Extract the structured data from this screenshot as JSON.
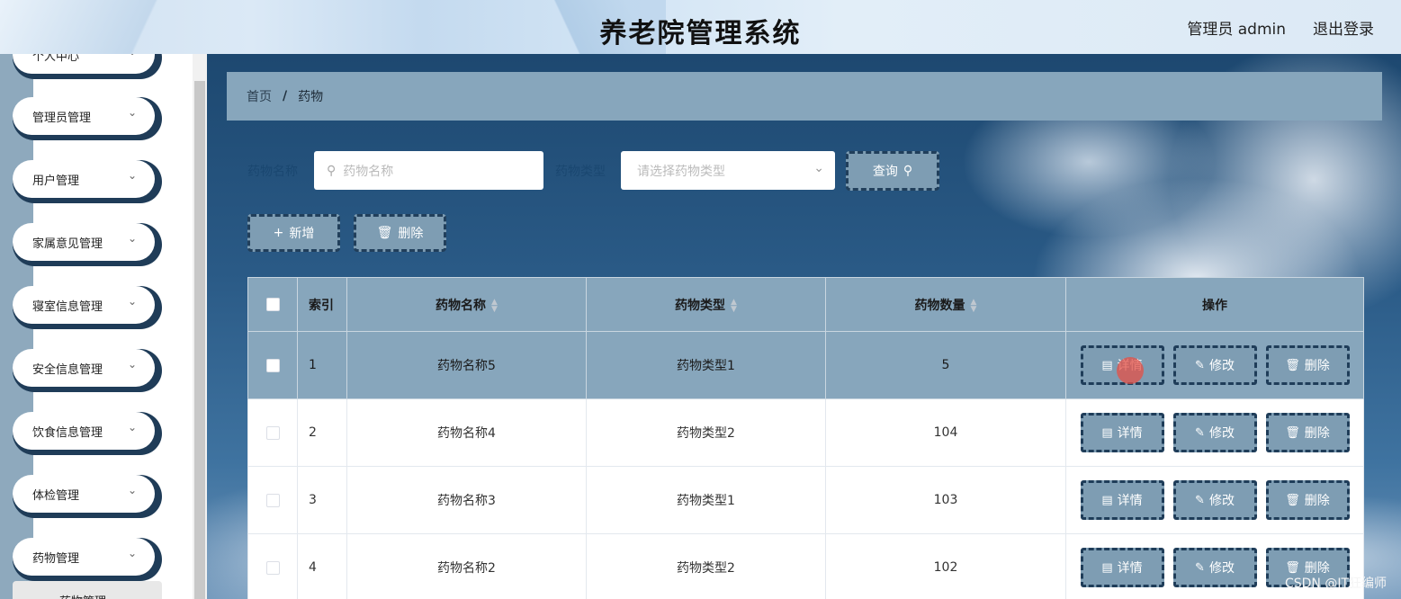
{
  "header": {
    "title": "养老院管理系统",
    "user": "管理员 admin",
    "logout": "退出登录"
  },
  "sidebar": {
    "items": [
      {
        "label": "个人中心"
      },
      {
        "label": "管理员管理"
      },
      {
        "label": "用户管理"
      },
      {
        "label": "家属意见管理"
      },
      {
        "label": "寝室信息管理"
      },
      {
        "label": "安全信息管理"
      },
      {
        "label": "饮食信息管理"
      },
      {
        "label": "体检管理"
      },
      {
        "label": "药物管理"
      }
    ],
    "sub_item": "药物管理"
  },
  "breadcrumb": {
    "home": "首页",
    "separator": "/",
    "current": "药物"
  },
  "search": {
    "name_label": "药物名称",
    "name_placeholder": "药物名称",
    "type_label": "药物类型",
    "type_placeholder": "请选择药物类型",
    "query_button": "查询"
  },
  "actions": {
    "add": "新增",
    "delete": "删除"
  },
  "table": {
    "headers": {
      "index": "索引",
      "name": "药物名称",
      "type": "药物类型",
      "qty": "药物数量",
      "ops": "操作"
    },
    "rows": [
      {
        "index": "1",
        "name": "药物名称5",
        "type": "药物类型1",
        "qty": "5"
      },
      {
        "index": "2",
        "name": "药物名称4",
        "type": "药物类型2",
        "qty": "104"
      },
      {
        "index": "3",
        "name": "药物名称3",
        "type": "药物类型1",
        "qty": "103"
      },
      {
        "index": "4",
        "name": "药物名称2",
        "type": "药物类型2",
        "qty": "102"
      }
    ],
    "row_buttons": {
      "detail": "详情",
      "edit": "修改",
      "delete": "删除"
    }
  },
  "watermark": "CSDN @IT狂编师",
  "colors": {
    "accent": "#87a6bc",
    "dark": "#1f3c58",
    "button": "#7e9db3"
  }
}
